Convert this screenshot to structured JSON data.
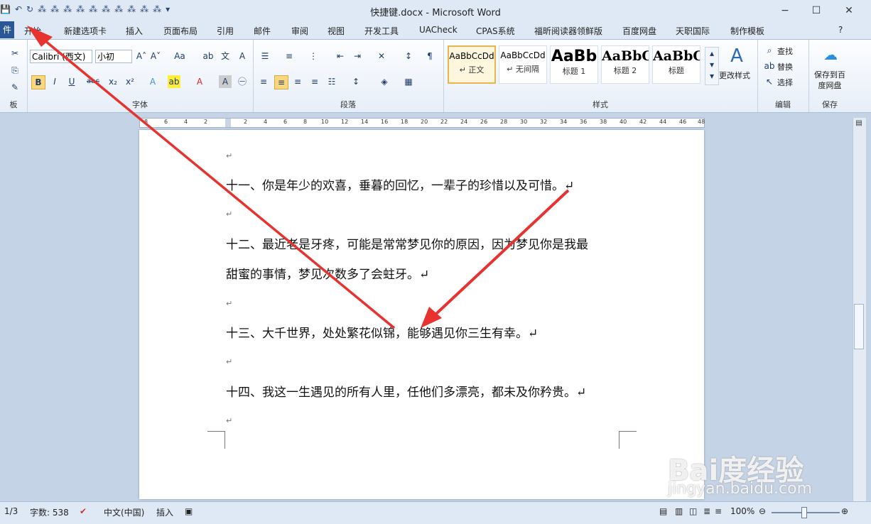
{
  "window": {
    "title": "快捷键.docx - Microsoft Word",
    "minimize": "−",
    "maximize": "☐",
    "close": "✕"
  },
  "qat": [
    "💾",
    "↶",
    "↻",
    "⁂",
    "⁂",
    "⁂",
    "⁂",
    "⁂",
    "⁂",
    "⁂",
    "⁂",
    "⁂",
    "⁂",
    "▾"
  ],
  "file_tab": "件",
  "tabs": [
    "开始",
    "新建选项卡",
    "插入",
    "页面布局",
    "引用",
    "邮件",
    "审阅",
    "视图",
    "开发工具",
    "UACheck",
    "CPAS系统",
    "福昕阅读器领鲜版",
    "百度网盘",
    "天职国际",
    "制作模板"
  ],
  "help": "?",
  "ribbon": {
    "clipboard_label": "板",
    "font": {
      "name": "Calibri (西文)",
      "size": "小初",
      "label": "字体",
      "buttons": [
        "B",
        "I",
        "U",
        "abc",
        "x₂",
        "x²"
      ]
    },
    "paragraph_label": "段落",
    "styles": {
      "label": "样式",
      "items": [
        {
          "sample": "AaBbCcDd",
          "name": "↵ 正文"
        },
        {
          "sample": "AaBbCcDd",
          "name": "↵ 无间隔"
        },
        {
          "sample": "AaBb",
          "name": "标题 1"
        },
        {
          "sample": "AaBbC",
          "name": "标题 2"
        },
        {
          "sample": "AaBbC",
          "name": "标题"
        }
      ],
      "change": "更改样式"
    },
    "editing": {
      "label": "编辑",
      "find": "查找",
      "replace": "替换",
      "select": "选择"
    },
    "save": {
      "label": "保存",
      "button": "保存到百度网盘"
    }
  },
  "ruler_ticks": [
    "8",
    "6",
    "4",
    "2",
    "",
    "2",
    "4",
    "6",
    "8",
    "10",
    "12",
    "14",
    "16",
    "18",
    "20",
    "22",
    "24",
    "26",
    "28",
    "30",
    "32",
    "34",
    "36",
    "38",
    "40",
    "42",
    "44",
    "46",
    "48"
  ],
  "document": {
    "mark": "↵",
    "paragraphs": [
      "十一、你是年少的欢喜，垂暮的回忆，一辈子的珍惜以及可惜。↵",
      "十二、最近老是牙疼，可能是常常梦见你的原因，因为梦见你是我最",
      "甜蜜的事情，梦见次数多了会蛀牙。↵",
      "十三、大千世界，处处繁花似锦，能够遇见你三生有幸。↵",
      "十四、我这一生遇见的所有人里，任他们多漂亮，都未及你矜贵。↵"
    ]
  },
  "status": {
    "page": "1/3",
    "words": "字数: 538",
    "language": "中文(中国)",
    "mode": "插入",
    "zoom": "100%"
  },
  "watermark": {
    "brand": "Bai度经验",
    "sub": "jingyan.baidu.com"
  },
  "colors": {
    "arrow": "#e8322f",
    "file_tab": "#2b5797"
  }
}
